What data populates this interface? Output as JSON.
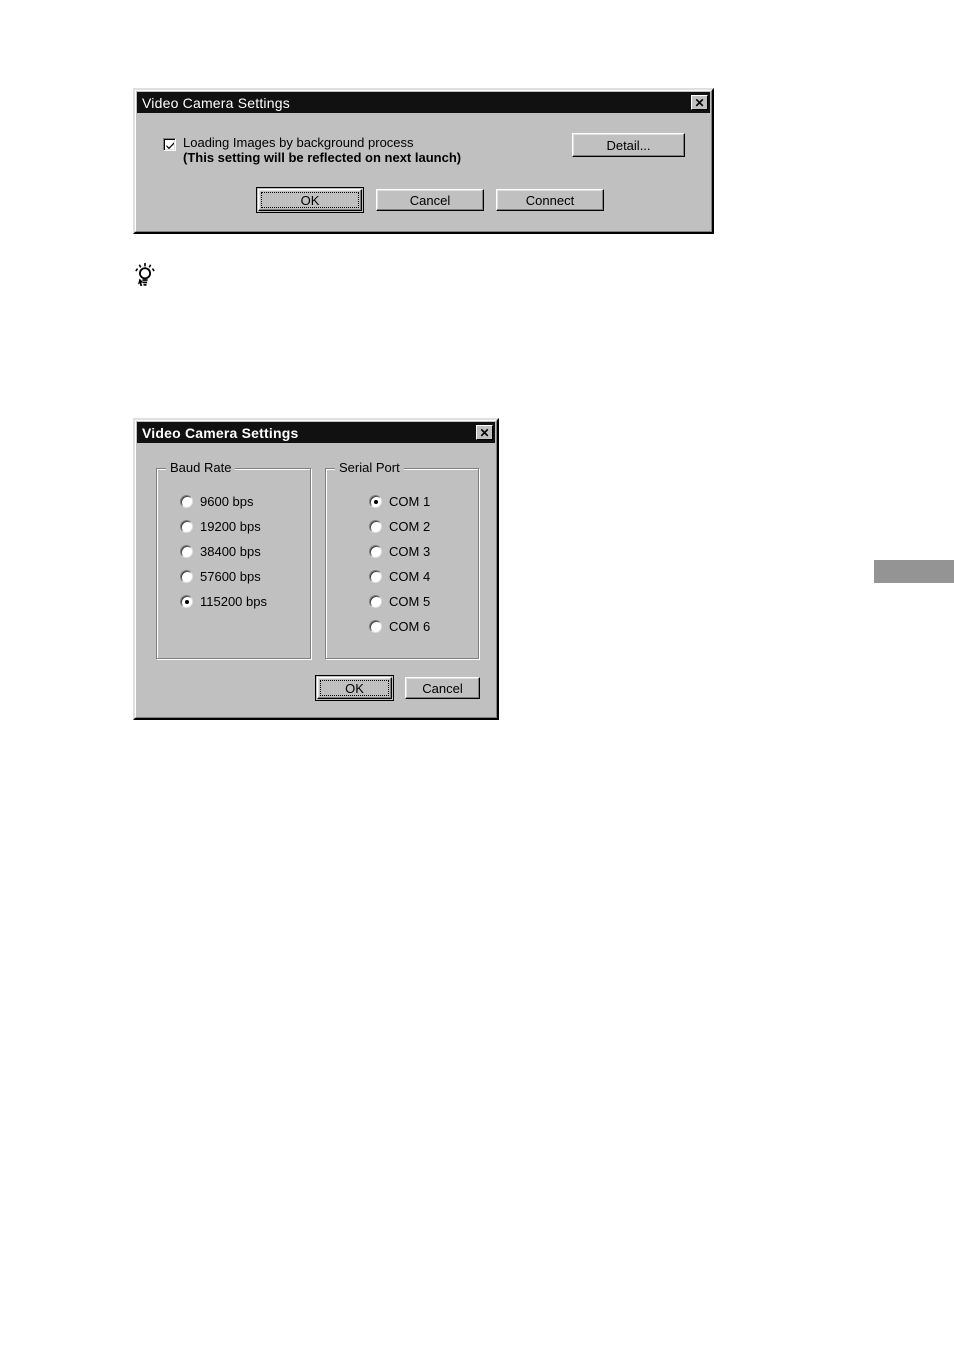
{
  "page": {
    "background_color": "#ffffff",
    "dialog_face_color": "#c0c0c0",
    "titlebar_color": "#111111",
    "page_tab_color": "#949494"
  },
  "tip_marker": {
    "icon": "lightbulb-tip-icon"
  },
  "page_tab": {
    "label": ""
  },
  "dialog_main": {
    "title": "Video Camera Settings",
    "close_button": {
      "icon": "close-icon",
      "glyph": "✕"
    },
    "checkbox": {
      "checked": true,
      "line1": "Loading Images by background process",
      "line2": "(This setting will be reflected on next launch)"
    },
    "buttons": {
      "detail": "Detail...",
      "ok": "OK",
      "cancel": "Cancel",
      "connect": "Connect"
    },
    "default_button": "OK"
  },
  "dialog_serial": {
    "title": "Video Camera Settings",
    "close_button": {
      "icon": "close-icon",
      "glyph": "✕"
    },
    "baud_rate_group": {
      "title": "Baud Rate",
      "selected": "115200 bps",
      "options": [
        "9600 bps",
        "19200 bps",
        "38400 bps",
        "57600 bps",
        "115200 bps"
      ]
    },
    "serial_port_group": {
      "title": "Serial Port",
      "selected": "COM 1",
      "options": [
        "COM 1",
        "COM 2",
        "COM 3",
        "COM 4",
        "COM 5",
        "COM 6"
      ]
    },
    "buttons": {
      "ok": "OK",
      "cancel": "Cancel"
    },
    "default_button": "OK"
  }
}
